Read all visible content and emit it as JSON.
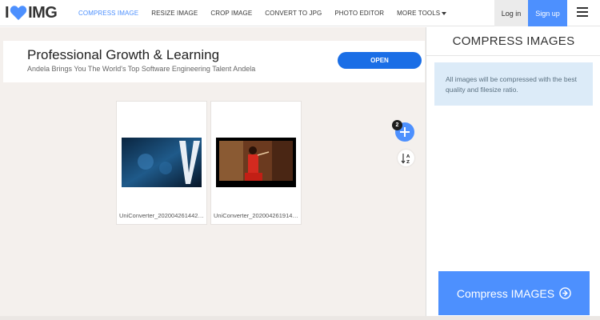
{
  "logo": {
    "text_left": "I",
    "text_right": "IMG"
  },
  "nav": {
    "items": [
      {
        "label": "COMPRESS IMAGE",
        "active": true
      },
      {
        "label": "RESIZE IMAGE",
        "active": false
      },
      {
        "label": "CROP IMAGE",
        "active": false
      },
      {
        "label": "CONVERT TO JPG",
        "active": false
      },
      {
        "label": "PHOTO EDITOR",
        "active": false
      },
      {
        "label": "MORE TOOLS",
        "active": false
      }
    ],
    "login_label": "Log in",
    "signup_label": "Sign up"
  },
  "ad": {
    "title": "Professional Growth & Learning",
    "subtitle": "Andela Brings You The World's Top Software Engineering Talent Andela",
    "button_label": "OPEN"
  },
  "files": {
    "count": "2",
    "items": [
      {
        "name": "UniConverter_2020042614422..."
      },
      {
        "name": "UniConverter_2020042619140..."
      }
    ]
  },
  "sidebar": {
    "title": "COMPRESS IMAGES",
    "info": "All images will be compressed with the best quality and filesize ratio.",
    "compress_label": "Compress IMAGES"
  },
  "colors": {
    "accent": "#4d90fe",
    "ad_button": "#1a6ee6",
    "workspace_bg": "#f4f0ed",
    "info_bg": "#dcebf8"
  }
}
